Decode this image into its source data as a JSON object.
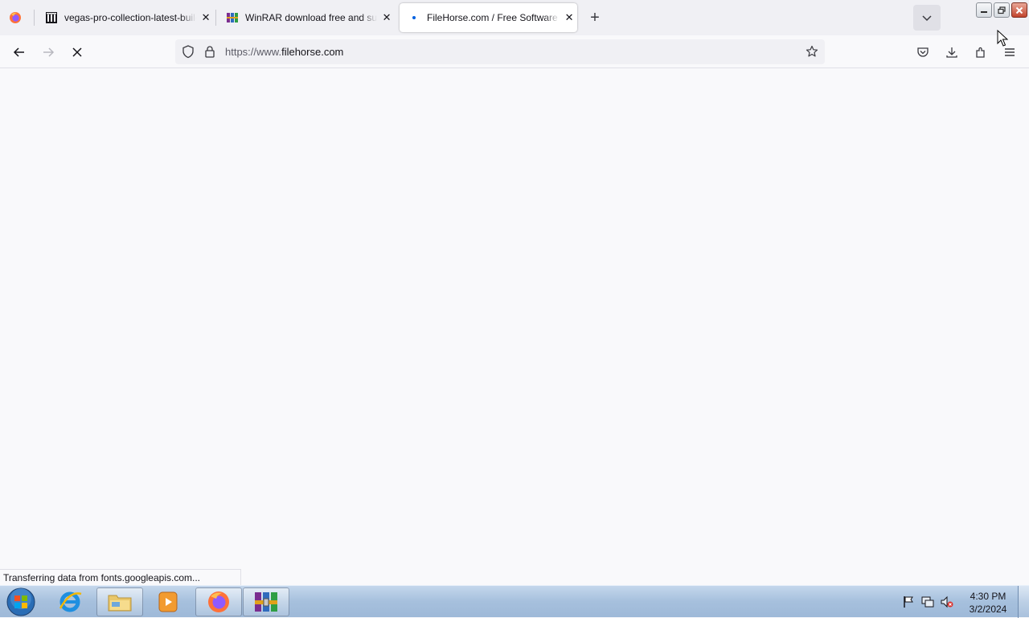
{
  "browser": {
    "tabs": [
      {
        "title": "vegas-pro-collection-latest-build",
        "favicon": "archive-building-icon",
        "active": false
      },
      {
        "title": "WinRAR download free and support",
        "favicon": "winrar-books-icon",
        "active": false
      },
      {
        "title": "FileHorse.com / Free Software Downloads",
        "favicon": "loading-dot-icon",
        "active": true
      }
    ],
    "new_tab_label": "+",
    "url_scheme": "https://www.",
    "url_host": "filehorse.com",
    "status_text": "Transferring data from fonts.googleapis.com..."
  },
  "taskbar": {
    "apps": [
      "internet-explorer",
      "windows-explorer",
      "media-player",
      "firefox",
      "winrar"
    ],
    "clock_time": "4:30 PM",
    "clock_date": "3/2/2024"
  },
  "colors": {
    "tabbar_bg": "#f0f0f4",
    "accent_blue": "#0061e0",
    "taskbar_bg": "#a6c0dd"
  }
}
